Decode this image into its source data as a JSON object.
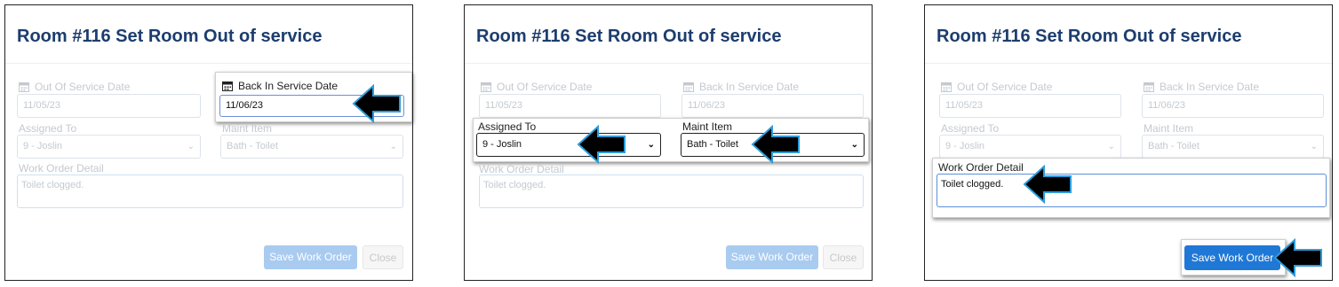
{
  "steps": [
    {
      "title": "Room #116 Set Room Out of service",
      "out_of_service_label": "Out Of Service Date",
      "out_of_service_value": "11/05/23",
      "back_in_service_label": "Back In Service Date",
      "back_in_service_value": "11/06/23",
      "assigned_to_label": "Assigned To",
      "assigned_to_value": "9 - Joslin",
      "maint_item_label": "Maint Item",
      "maint_item_value": "Bath - Toilet",
      "work_order_label": "Work Order Detail",
      "work_order_value": "Toilet clogged.",
      "save_label": "Save Work Order",
      "close_label": "Close"
    },
    {
      "title": "Room #116 Set Room Out of service",
      "out_of_service_label": "Out Of Service Date",
      "out_of_service_value": "11/05/23",
      "back_in_service_label": "Back In Service Date",
      "back_in_service_value": "11/06/23",
      "assigned_to_label": "Assigned To",
      "assigned_to_value": "9 - Joslin",
      "maint_item_label": "Maint Item",
      "maint_item_value": "Bath - Toilet",
      "work_order_label": "Work Order Detail",
      "work_order_value": "Toilet clogged.",
      "save_label": "Save Work Order",
      "close_label": "Close"
    },
    {
      "title": "Room #116 Set Room Out of service",
      "out_of_service_label": "Out Of Service Date",
      "out_of_service_value": "11/05/23",
      "back_in_service_label": "Back In Service Date",
      "back_in_service_value": "11/06/23",
      "assigned_to_label": "Assigned To",
      "assigned_to_value": "9 - Joslin",
      "maint_item_label": "Maint Item",
      "maint_item_value": "Bath - Toilet",
      "work_order_label": "Work Order Detail",
      "work_order_value": "Toilet clogged.",
      "save_label": "Save Work Order"
    }
  ],
  "icons": {
    "calendar": "calendar-icon",
    "chevron": "chevron-down-icon",
    "arrow": "pointer-arrow-icon"
  },
  "colors": {
    "title": "#1c3d6e",
    "primary_button": "#1f78d6",
    "disabled_button": "#a9cbf0"
  }
}
